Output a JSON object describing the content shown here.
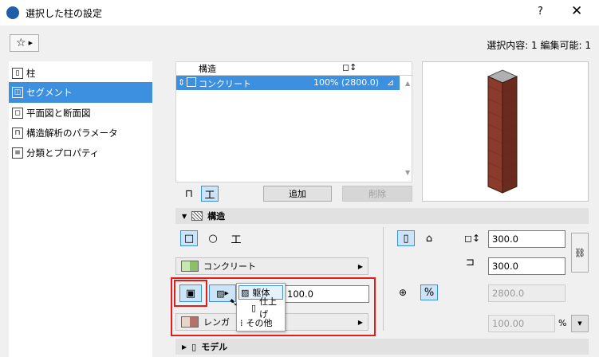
{
  "window": {
    "title": "選択した柱の設定",
    "help": "?",
    "close": "✕",
    "favorites_icon": "star-icon"
  },
  "selection_info": "選択内容: 1 編集可能: 1",
  "nav": {
    "items": [
      {
        "label": "柱",
        "icon": "column-icon"
      },
      {
        "label": "セグメント",
        "icon": "segment-icon",
        "selected": true
      },
      {
        "label": "平面図と断面図",
        "icon": "floorplan-icon"
      },
      {
        "label": "構造解析のパラメータ",
        "icon": "structural-analysis-icon"
      },
      {
        "label": "分類とプロパティ",
        "icon": "classification-icon"
      }
    ]
  },
  "table": {
    "col_structure": "構造",
    "col_size_icon": "◻↕",
    "rows": [
      {
        "name": "コンクリート",
        "value": "100% (2800.0)"
      }
    ]
  },
  "buttons": {
    "add": "追加",
    "delete": "削除"
  },
  "section_structure": {
    "title": "構造",
    "material_select": "コンクリート",
    "thickness_value": "100.0",
    "finish_select": "レンガ"
  },
  "popup_menu": {
    "items": [
      "躯体",
      "仕上げ",
      "その他"
    ]
  },
  "dimensions": {
    "width": "300.0",
    "depth": "300.0",
    "height": "2800.0",
    "percent": "100.00",
    "percent_unit": "%"
  },
  "section_model": {
    "title": "モデル"
  },
  "colors": {
    "accent": "#3d8fe0",
    "highlight_red": "#e31c1c",
    "brick": "#8a3b2c"
  }
}
